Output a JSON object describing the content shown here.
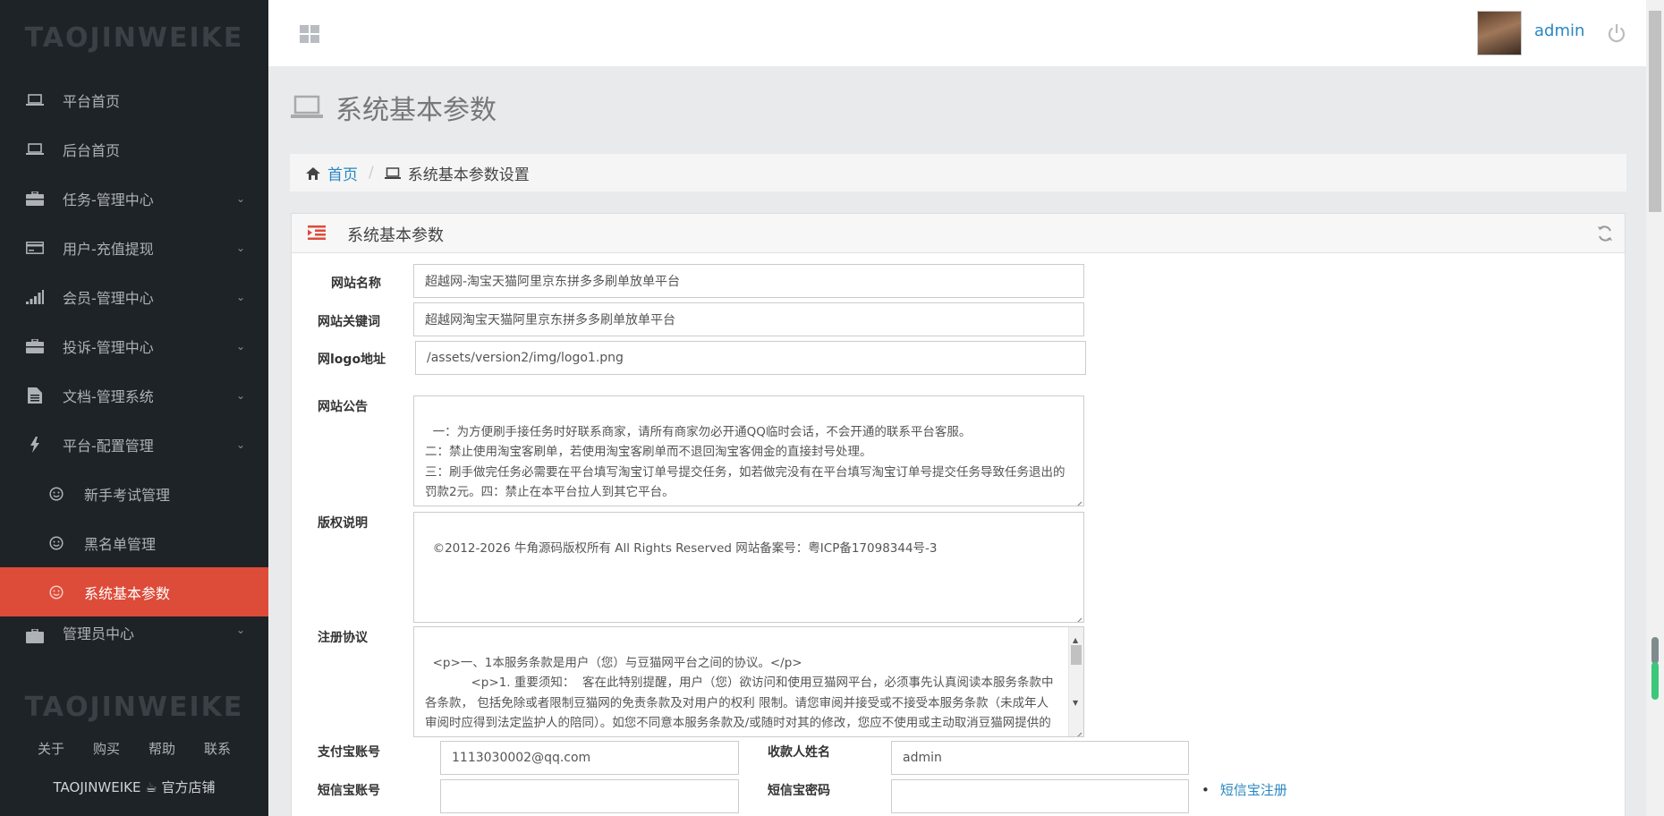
{
  "brand": "TAOJINWEIKE",
  "sidebar": {
    "items": [
      {
        "label": "平台首页",
        "icon": "laptop-icon"
      },
      {
        "label": "后台首页",
        "icon": "laptop-icon"
      },
      {
        "label": "任务-管理中心",
        "icon": "briefcase-icon"
      },
      {
        "label": "用户-充值提现",
        "icon": "credit-card-icon"
      },
      {
        "label": "会员-管理中心",
        "icon": "signal-icon"
      },
      {
        "label": "投诉-管理中心",
        "icon": "briefcase-icon"
      },
      {
        "label": "文档-管理系统",
        "icon": "file-icon"
      },
      {
        "label": "平台-配置管理",
        "icon": "bolt-icon"
      }
    ],
    "sub_items": [
      {
        "label": "新手考试管理",
        "icon": "smile-icon"
      },
      {
        "label": "黑名单管理",
        "icon": "smile-icon"
      },
      {
        "label": "系统基本参数",
        "icon": "smile-icon",
        "active": true
      }
    ],
    "cut_item": {
      "label": "管理员中心",
      "icon": "briefcase-icon"
    },
    "footer_brand": "TAOJINWEIKE",
    "footer_links": [
      "关于",
      "购买",
      "帮助",
      "联系"
    ],
    "footer_shop": "TAOJINWEIKE ☕ 官方店铺"
  },
  "header": {
    "user": "admin"
  },
  "page": {
    "title": "系统基本参数",
    "breadcrumb_home": "首页",
    "breadcrumb_current": "系统基本参数设置",
    "box_title": "系统基本参数"
  },
  "form": {
    "site_name_label": "网站名称",
    "site_name": "超越网-淘宝天猫阿里京东拼多多刷单放单平台",
    "keywords_label": "网站关键词",
    "keywords": "超越网淘宝天猫阿里京东拼多多刷单放单平台",
    "logo_label": "网logo地址",
    "logo": "/assets/version2/img/logo1.png",
    "notice_label": "网站公告",
    "notice": "一：为方便刷手接任务时好联系商家，请所有商家勿必开通QQ临时会话，不会开通的联系平台客服。\n二：禁止使用淘宝客刷单，若使用淘宝客刷单而不退回淘宝客佣金的直接封号处理。\n三：刷手做完任务必需要在平台填写淘宝订单号提交任务，如若做完没有在平台填写淘宝订单号提交任务导致任务退出的罚款2元。四：禁止在本平台拉人到其它平台。",
    "copyright_label": "版权说明",
    "copyright": "©2012-2026 牛角源码版权所有 All Rights Reserved 网站备案号：粤ICP备17098344号-3",
    "agreement_label": "注册协议",
    "agreement": "<p>一、1本服务条款是用户（您）与豆猫网平台之间的协议。</p>\n            <p>1. 重要须知：  客在此特别提醒，用户（您）欲访问和使用豆猫网平台，必须事先认真阅读本服务条款中各条款， 包括免除或者限制豆猫网的免责条款及对用户的权利 限制。请您审阅并接受或不接受本服务条款（未成年人审阅时应得到法定监护人的陪同）。如您不同意本服务条款及/或随时对其的修改，您应不使用或主动取消豆猫网提供的服务。您的使用行为将被视为您对本服务条款全部的完全接受，包括",
    "alipay_label": "支付宝账号",
    "alipay": "1113030002@qq.com",
    "payee_label": "收款人姓名",
    "payee": "admin",
    "sms_account_label": "短信宝账号",
    "sms_account": "",
    "sms_password_label": "短信宝密码",
    "sms_password": "",
    "sms_register_link": "短信宝注册"
  },
  "colors": {
    "sidebar_bg": "#1e2327",
    "active_bg": "#dd4b39",
    "link": "#2a86c3"
  }
}
